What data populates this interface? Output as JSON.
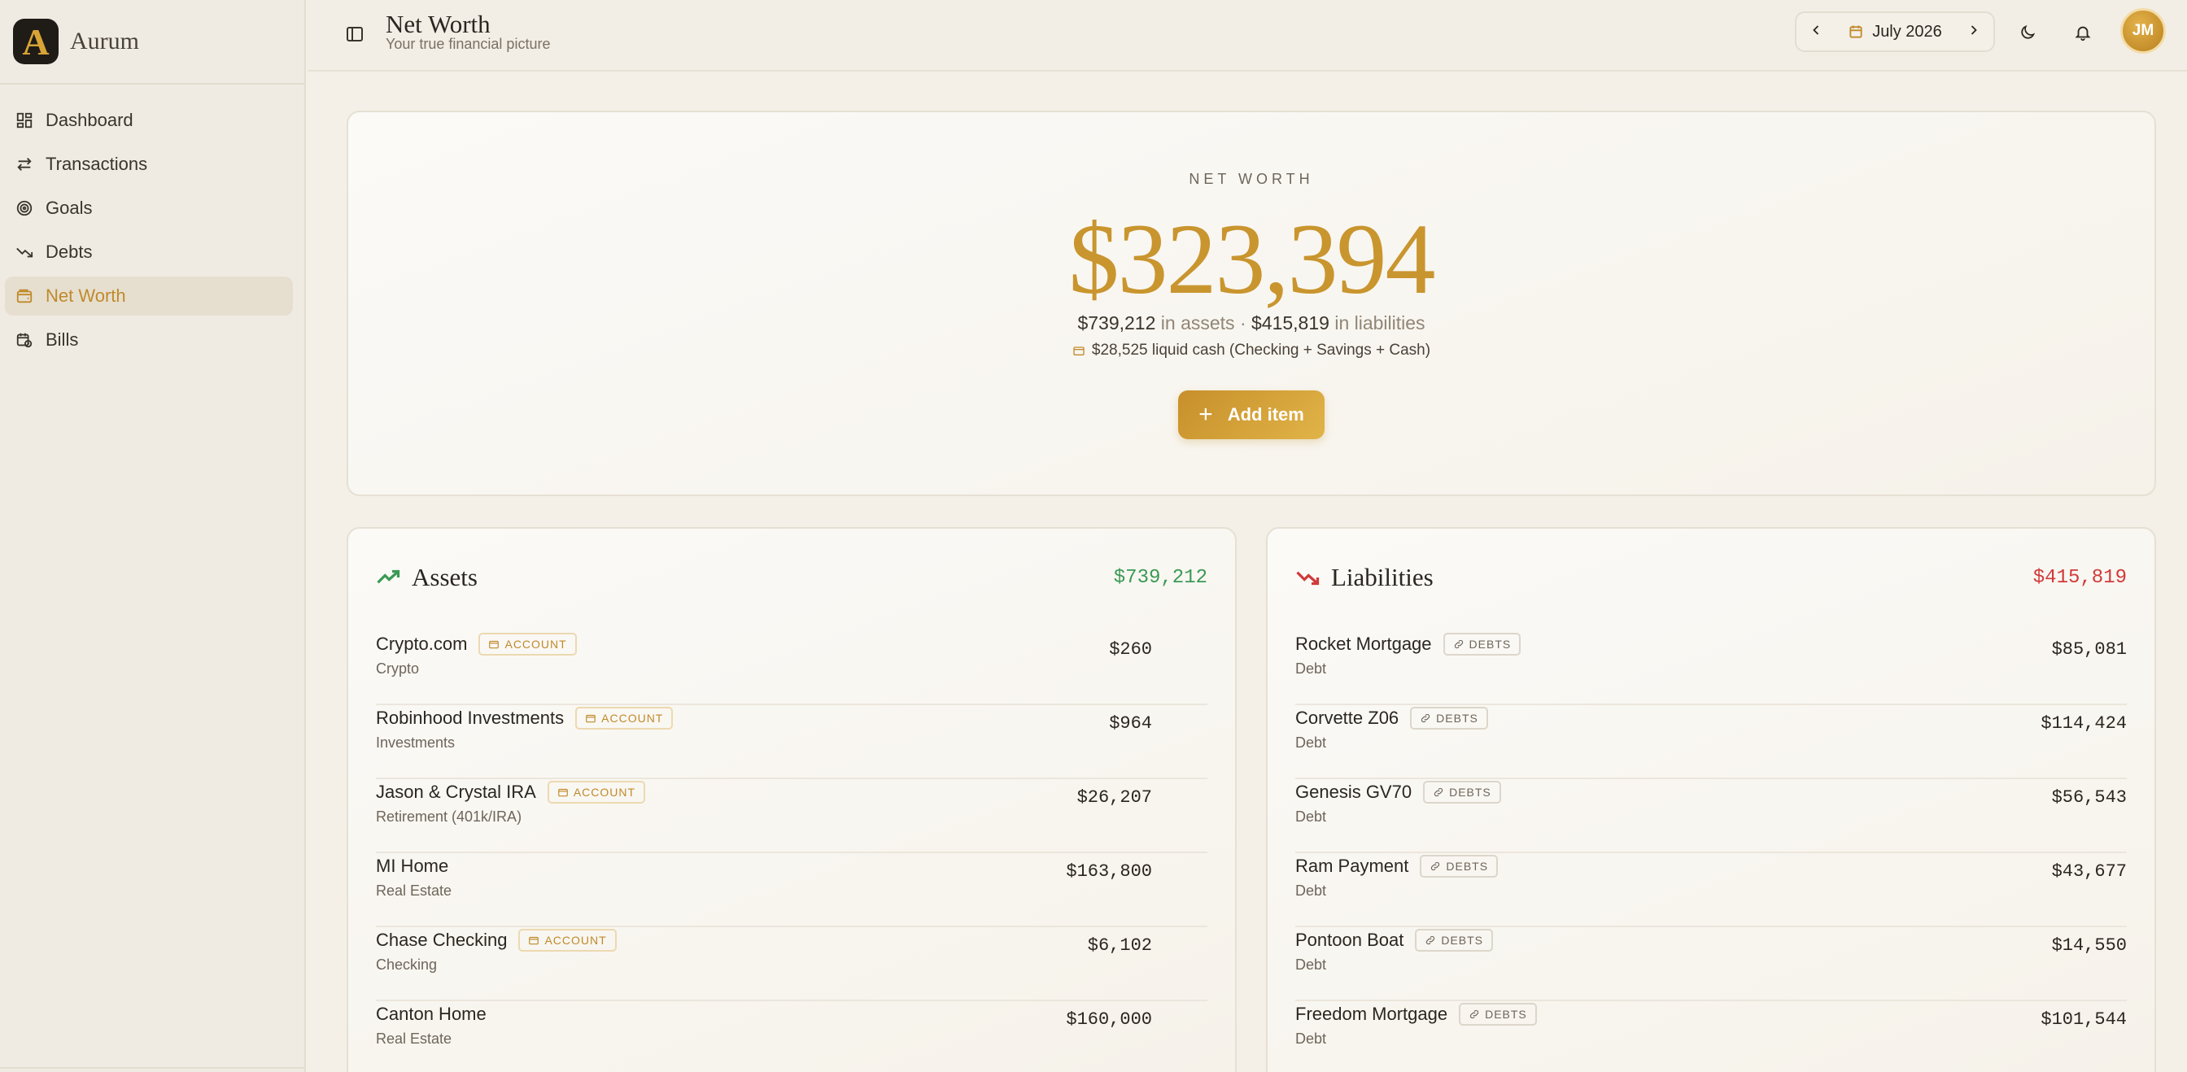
{
  "app": {
    "name": "Aurum",
    "logo_letter": "A"
  },
  "sidebar": {
    "items": [
      {
        "label": "Dashboard",
        "icon": "grid-icon",
        "active": false
      },
      {
        "label": "Transactions",
        "icon": "arrows-swap-icon",
        "active": false
      },
      {
        "label": "Goals",
        "icon": "target-icon",
        "active": false
      },
      {
        "label": "Debts",
        "icon": "trending-down-icon",
        "active": false
      },
      {
        "label": "Net Worth",
        "icon": "wallet-icon",
        "active": true
      },
      {
        "label": "Bills",
        "icon": "calendar-clock-icon",
        "active": false
      }
    ]
  },
  "header": {
    "title": "Net Worth",
    "subtitle": "Your true financial picture",
    "month": "July 2026",
    "avatar_initials": "JM"
  },
  "summary": {
    "label": "NET WORTH",
    "value": "$323,394",
    "assets_amount": "$739,212",
    "assets_text": "in assets",
    "separator": "·",
    "liabilities_amount": "$415,819",
    "liabilities_text": "in liabilities",
    "liquid_cash": "$28,525 liquid cash (Checking + Savings + Cash)",
    "add_button": "Add item"
  },
  "assets": {
    "title": "Assets",
    "total": "$739,212",
    "color": "#3a9a55",
    "items": [
      {
        "name": "Crypto.com",
        "badge": "ACCOUNT",
        "category": "Crypto",
        "value": "$260"
      },
      {
        "name": "Robinhood Investments",
        "badge": "ACCOUNT",
        "category": "Investments",
        "value": "$964"
      },
      {
        "name": "Jason & Crystal IRA",
        "badge": "ACCOUNT",
        "category": "Retirement (401k/IRA)",
        "value": "$26,207"
      },
      {
        "name": "MI Home",
        "badge": "",
        "category": "Real Estate",
        "value": "$163,800"
      },
      {
        "name": "Chase Checking",
        "badge": "ACCOUNT",
        "category": "Checking",
        "value": "$6,102"
      },
      {
        "name": "Canton Home",
        "badge": "",
        "category": "Real Estate",
        "value": "$160,000"
      }
    ]
  },
  "liabilities": {
    "title": "Liabilities",
    "total": "$415,819",
    "color": "#d03a3a",
    "items": [
      {
        "name": "Rocket Mortgage",
        "badge": "DEBTS",
        "category": "Debt",
        "value": "$85,081"
      },
      {
        "name": "Corvette Z06",
        "badge": "DEBTS",
        "category": "Debt",
        "value": "$114,424"
      },
      {
        "name": "Genesis GV70",
        "badge": "DEBTS",
        "category": "Debt",
        "value": "$56,543"
      },
      {
        "name": "Ram Payment",
        "badge": "DEBTS",
        "category": "Debt",
        "value": "$43,677"
      },
      {
        "name": "Pontoon Boat",
        "badge": "DEBTS",
        "category": "Debt",
        "value": "$14,550"
      },
      {
        "name": "Freedom Mortgage",
        "badge": "DEBTS",
        "category": "Debt",
        "value": "$101,544"
      }
    ]
  }
}
